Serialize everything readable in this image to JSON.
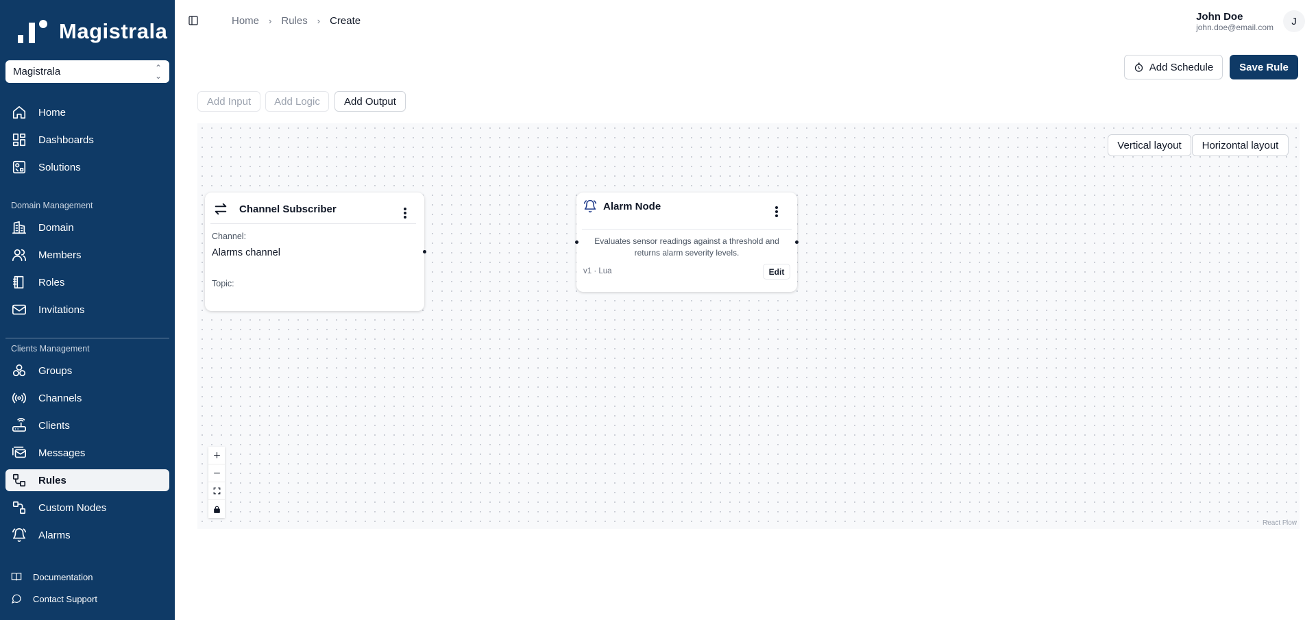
{
  "app": {
    "brand": "Magistrala",
    "colors": {
      "sidebar": "#0f3a66",
      "primary": "#0f3a66",
      "canvas": "#f8f9fb"
    }
  },
  "sidebar": {
    "domain_selector": {
      "value": "Magistrala",
      "icon": "chevrons-up-down-icon"
    },
    "top_items": [
      {
        "label": "Home",
        "icon": "home-icon"
      },
      {
        "label": "Dashboards",
        "icon": "dashboard-icon"
      },
      {
        "label": "Solutions",
        "icon": "solutions-icon"
      }
    ],
    "domain_section": {
      "title": "Domain Management",
      "items": [
        {
          "label": "Domain",
          "icon": "building-icon"
        },
        {
          "label": "Members",
          "icon": "users-icon"
        },
        {
          "label": "Roles",
          "icon": "book-icon"
        },
        {
          "label": "Invitations",
          "icon": "mail-icon"
        }
      ]
    },
    "clients_section": {
      "title": "Clients Management",
      "items": [
        {
          "label": "Groups",
          "icon": "groups-icon"
        },
        {
          "label": "Channels",
          "icon": "broadcast-icon"
        },
        {
          "label": "Clients",
          "icon": "router-icon"
        },
        {
          "label": "Messages",
          "icon": "mail-stack-icon"
        },
        {
          "label": "Rules",
          "icon": "route-icon",
          "active": true
        },
        {
          "label": "Custom Nodes",
          "icon": "custom-nodes-icon"
        },
        {
          "label": "Alarms",
          "icon": "bell-icon"
        }
      ]
    },
    "footer": [
      {
        "label": "Documentation",
        "icon": "book-open-icon"
      },
      {
        "label": "Contact Support",
        "icon": "message-circle-icon"
      }
    ]
  },
  "header": {
    "breadcrumb": [
      "Home",
      "Rules",
      "Create"
    ],
    "user": {
      "name": "John Doe",
      "email": "john.doe@email.com",
      "initial": "J"
    }
  },
  "toolbar": {
    "add_schedule": "Add Schedule",
    "save_rule": "Save Rule",
    "add_input": "Add Input",
    "add_logic": "Add Logic",
    "add_output": "Add Output"
  },
  "canvas": {
    "vertical_layout": "Vertical layout",
    "horizontal_layout": "Horizontal layout",
    "attribution": "React Flow",
    "nodes": {
      "subscriber": {
        "title": "Channel Subscriber",
        "channel_label": "Channel:",
        "channel_value": "Alarms channel",
        "topic_label": "Topic:"
      },
      "alarm": {
        "title": "Alarm Node",
        "description": "Evaluates sensor readings against a threshold and returns alarm severity levels.",
        "meta": "v1 · Lua",
        "edit": "Edit"
      }
    }
  }
}
